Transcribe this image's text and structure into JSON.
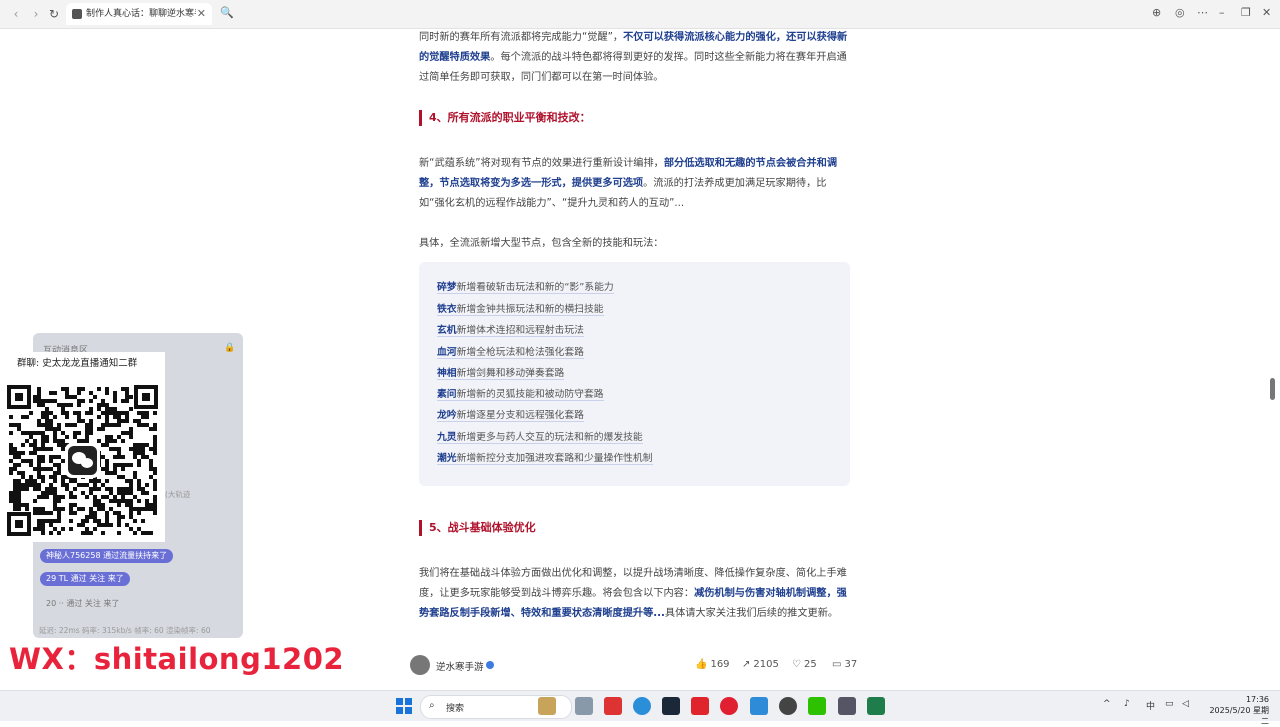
{
  "browser": {
    "tab_title": "制作人真心话：聊聊逆水寒手游",
    "tab_close": "✕",
    "search_glyph": "🔍"
  },
  "article": {
    "intro_a": "同时新的赛年所有流派都将完成能力“觉醒”，",
    "intro_b": "不仅可以获得流派核心能力的强化，还可以获得新的觉醒特质效果",
    "intro_c": "。每个流派的战斗特色都将得到更好的发挥。同时这些全新能力将在赛年开启通过简单任务即可获取，同门们都可以在第一时间体验。",
    "heading4": "4、所有流派的职业平衡和技改：",
    "p4_a": "新“武蕴系统”将对现有节点的效果进行重新设计编排，",
    "p4_b": "部分低选取和无趣的节点会被合并和调整，节点选取将变为多选一形式，提供更多可选项",
    "p4_c": "。流派的打法养成更加满足玩家期待，比如“强化玄机的远程作战能力”、“提升九灵和药人的互动”...",
    "p4_list_intro": "具体，全流派新增大型节点，包含全新的技能和玩法：",
    "list": [
      {
        "k": "碎梦",
        "t": "新增看破斩击玩法和新的“影”系能力"
      },
      {
        "k": "铁衣",
        "t": "新增金钟共振玩法和新的横扫技能"
      },
      {
        "k": "玄机",
        "t": "新增体术连招和远程射击玩法"
      },
      {
        "k": "血河",
        "t": "新增全枪玩法和枪法强化套路"
      },
      {
        "k": "神相",
        "t": "新增剑舞和移动弹奏套路"
      },
      {
        "k": "素问",
        "t": "新增新的灵狐技能和被动防守套路"
      },
      {
        "k": "龙吟",
        "t": "新增逐星分支和远程强化套路"
      },
      {
        "k": "九灵",
        "t": "新增更多与药人交互的玩法和新的爆发技能"
      },
      {
        "k": "潮光",
        "t": "新增新控分支加强进攻套路和少量操作性机制"
      }
    ],
    "heading5": "5、战斗基础体验优化",
    "p5_a": "我们将在基础战斗体验方面做出优化和调整，以提升战场清晰度、降低操作复杂度、简化上手难度，让更多玩家能够受到战斗博弈乐趣。将会包含以下内容：",
    "p5_b": "减伤机制与伤害对轴机制调整，强势套路反制手段新增、特效和重要状态清晰度提升等...",
    "p5_c": "具体请大家关注我们后续的推文更新。"
  },
  "author": {
    "name": "逆水寒手游",
    "likes": "169",
    "shares": "2105",
    "favorites": "25",
    "comments": "37"
  },
  "overlay": {
    "panel_title": "互动消息区",
    "qr_title": "群聊: 史太龙龙直播通知二群",
    "chip1": "神秘人756258 通过流量扶持来了",
    "chip2": "29  TL 通过 关注 来了",
    "chip3": "20  ·· 通过 关注 来了",
    "side_text": "(大轨迹",
    "footer": "延迟: 22ms   码率: 315kb/s   帧率: 60   渲染帧率: 60",
    "wx": "WX：shitailong1202"
  },
  "taskbar": {
    "search_label": "搜索",
    "ime": "中",
    "time": "17:36",
    "date": "2025/5/20 星期二"
  },
  "colors": {
    "accent_red": "#b0122c",
    "link_blue": "#1f3f8f",
    "wx_red": "#e8243c"
  }
}
